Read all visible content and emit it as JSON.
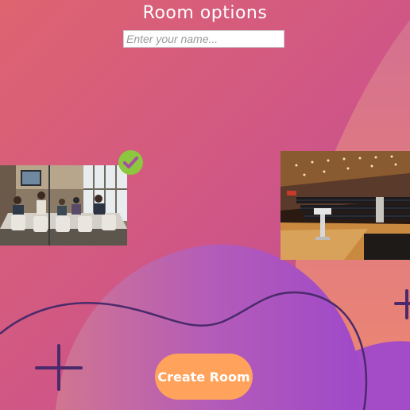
{
  "page": {
    "title": "Room options",
    "name_input": {
      "value": "",
      "placeholder": "Enter your name..."
    },
    "rooms": [
      {
        "image": "meeting-room-photo",
        "selected": true
      },
      {
        "image": "auditorium-photo",
        "selected": false
      }
    ],
    "selected_icon": "check-circle-icon",
    "create_label": "Create Room"
  },
  "colors": {
    "background_top": "#dd6273",
    "background_bottom": "#c14e93",
    "blob_pink": "#d8708f",
    "blob_purple": "#a64fc6",
    "blob_orange": "#f29070",
    "decoration_line": "#4a2a6a",
    "check_badge": "#8dc63f",
    "button": "#ffa35c"
  }
}
